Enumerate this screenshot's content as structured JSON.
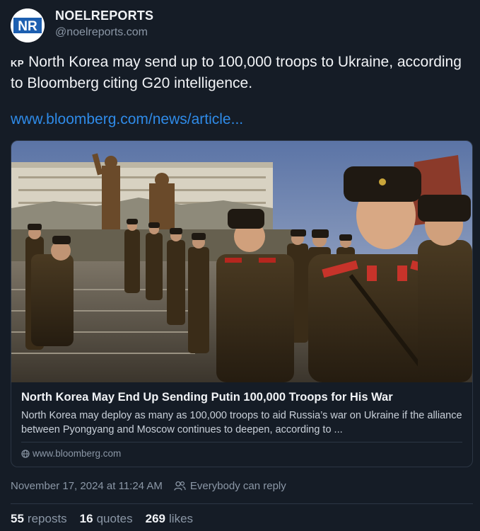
{
  "author": {
    "avatar_text": "NR",
    "name": "NOELREPORTS",
    "handle": "@noelreports.com"
  },
  "post": {
    "flag": "KP",
    "text": "North Korea may send up to 100,000 troops to Ukraine, according to Bloomberg citing G20 intelligence.",
    "link": "www.bloomberg.com/news/article..."
  },
  "card": {
    "title": "North Korea May End Up Sending Putin 100,000 Troops for His War",
    "description": "North Korea may deploy as many as 100,000 troops to aid Russia’s war on Ukraine if the alliance between Pyongyang and Moscow continues to deepen, according to ...",
    "domain": "www.bloomberg.com",
    "image_icon": "soldiers-parade-photo"
  },
  "meta": {
    "timestamp": "November 17, 2024 at 11:24 AM",
    "reply_setting": "Everybody can reply",
    "reply_icon": "people-icon"
  },
  "stats": {
    "reposts_count": "55",
    "reposts_label": "reposts",
    "quotes_count": "16",
    "quotes_label": "quotes",
    "likes_count": "269",
    "likes_label": "likes"
  },
  "colors": {
    "background": "#151c26",
    "link": "#2f8be8",
    "brand_blue": "#1d5fb0"
  }
}
